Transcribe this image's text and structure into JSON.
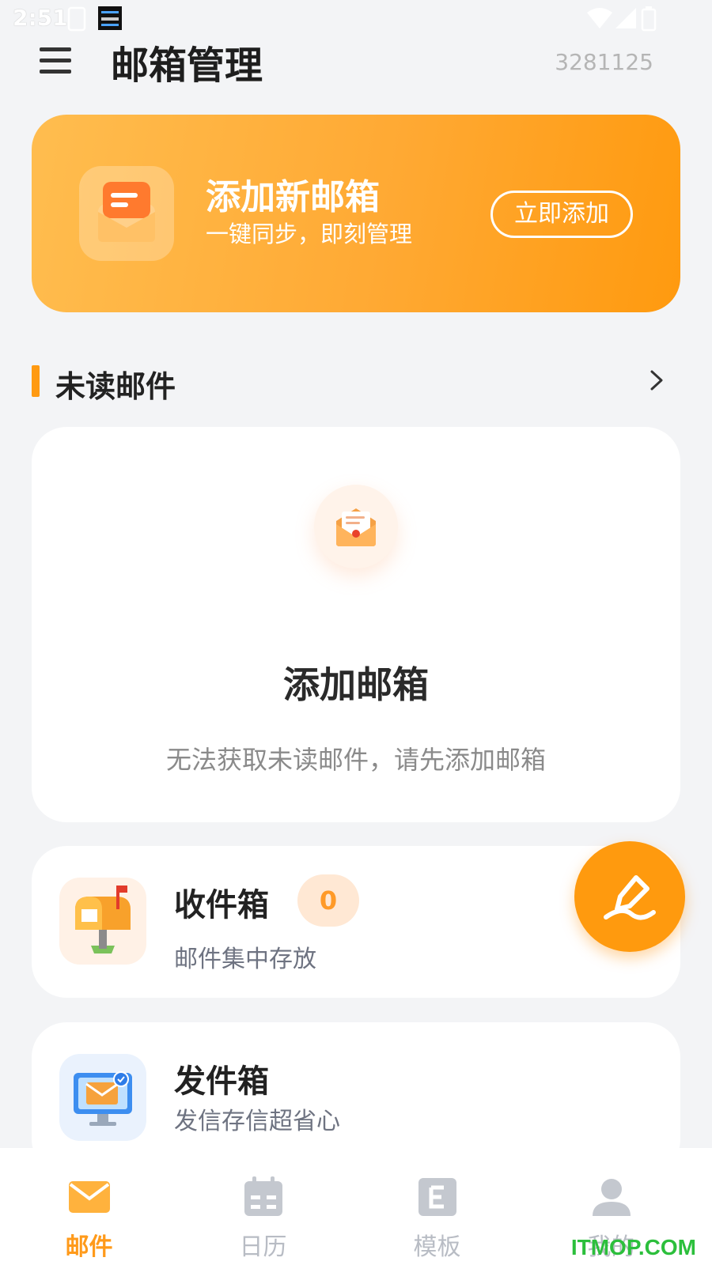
{
  "status_bar": {
    "time": "2:51"
  },
  "header": {
    "title": "邮箱管理",
    "account_id": "3281125"
  },
  "banner": {
    "title": "添加新邮箱",
    "subtitle": "一键同步，即刻管理",
    "button_label": "立即添加"
  },
  "unread_section": {
    "title": "未读邮件"
  },
  "empty_state": {
    "title": "添加邮箱",
    "description": "无法获取未读邮件，请先添加邮箱"
  },
  "inbox": {
    "title": "收件箱",
    "count": "0",
    "subtitle": "邮件集中存放"
  },
  "outbox": {
    "title": "发件箱",
    "subtitle": "发信存信超省心"
  },
  "bottom_nav": {
    "items": [
      {
        "label": "邮件",
        "icon": "mail-icon",
        "active": true
      },
      {
        "label": "日历",
        "icon": "calendar-icon",
        "active": false
      },
      {
        "label": "模板",
        "icon": "template-icon",
        "active": false
      },
      {
        "label": "我的",
        "icon": "profile-icon",
        "active": false
      }
    ]
  },
  "watermark": "ITMOP.COM",
  "colors": {
    "accent": "#ff9a12",
    "background": "#f3f4f6",
    "badge_bg": "#ffe8d4"
  }
}
